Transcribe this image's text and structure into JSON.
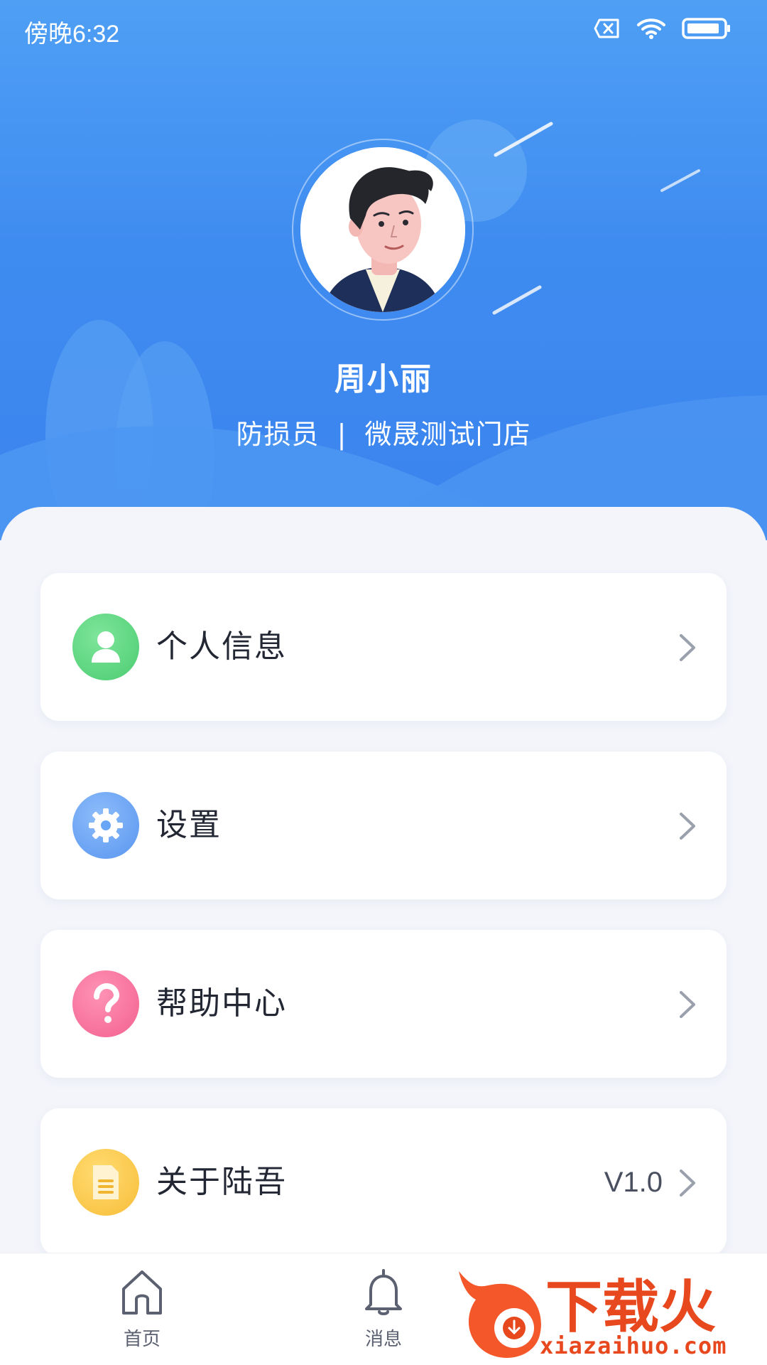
{
  "status_bar": {
    "time": "傍晚6:32",
    "icons": [
      "sim-blocked-icon",
      "wifi-icon",
      "battery-icon"
    ]
  },
  "profile": {
    "name": "周小丽",
    "role": "防损员",
    "store": "微晟测试门店",
    "separator": "|"
  },
  "menu": {
    "items": [
      {
        "label": "个人信息",
        "icon": "person-icon",
        "color": "#5fd884",
        "value": ""
      },
      {
        "label": "设置",
        "icon": "gear-icon",
        "color": "#6aa6f6",
        "value": ""
      },
      {
        "label": "帮助中心",
        "icon": "question-icon",
        "color": "#f76f9a",
        "value": ""
      },
      {
        "label": "关于陆吾",
        "icon": "document-icon",
        "color": "#fcc94a",
        "value": "V1.0"
      }
    ]
  },
  "tab_bar": {
    "items": [
      {
        "label": "首页",
        "icon": "home-icon"
      },
      {
        "label": "消息",
        "icon": "bell-icon"
      }
    ]
  },
  "watermark": {
    "logo_text": "下载火",
    "site": "xiazaihuo.com"
  },
  "colors": {
    "header_blue": "#3f8cf0",
    "background": "#f3f5fa",
    "text_dark": "#222733",
    "watermark": "#e8481e"
  }
}
